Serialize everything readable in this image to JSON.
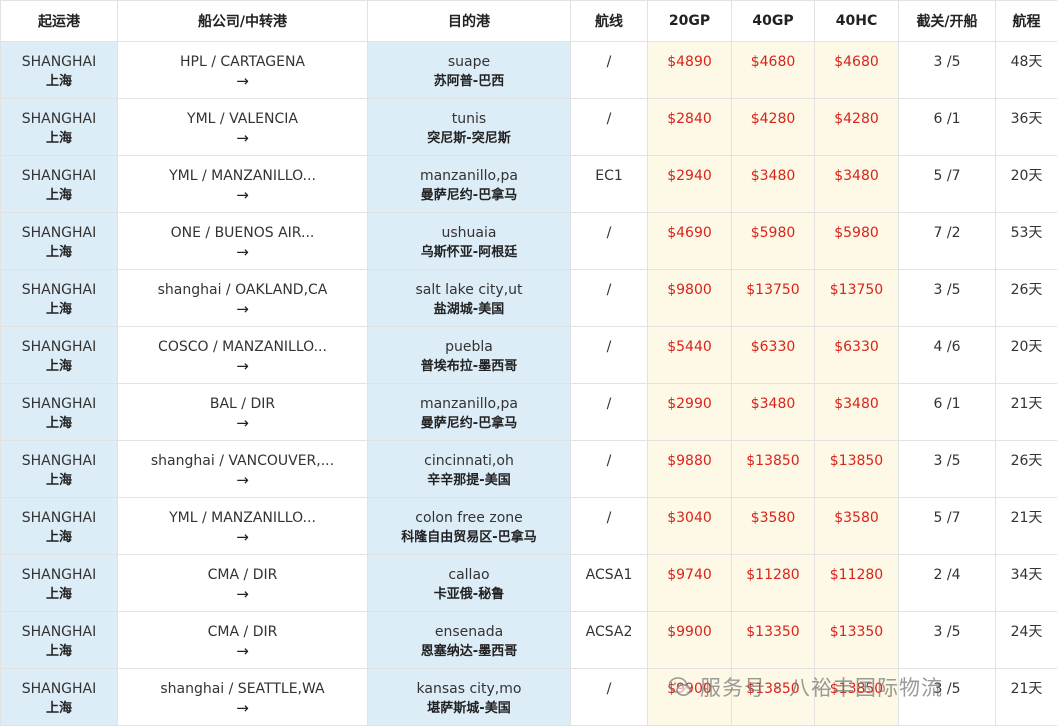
{
  "columns": [
    "起运港",
    "船公司/中转港",
    "目的港",
    "航线",
    "20GP",
    "40GP",
    "40HC",
    "截关/开船",
    "航程"
  ],
  "rows": [
    {
      "origin_en": "SHANGHAI",
      "origin_cn": "上海",
      "carrier": "HPL / CARTAGENA",
      "dest_en": "suape",
      "dest_cn": "苏阿普-巴西",
      "route": "/",
      "p20gp": "$4890",
      "p40gp": "$4680",
      "p40hc": "$4680",
      "cutoff": "3 /5",
      "transit": "48天"
    },
    {
      "origin_en": "SHANGHAI",
      "origin_cn": "上海",
      "carrier": "YML / VALENCIA",
      "dest_en": "tunis",
      "dest_cn": "突尼斯-突尼斯",
      "route": "/",
      "p20gp": "$2840",
      "p40gp": "$4280",
      "p40hc": "$4280",
      "cutoff": "6 /1",
      "transit": "36天"
    },
    {
      "origin_en": "SHANGHAI",
      "origin_cn": "上海",
      "carrier": "YML / MANZANILLO...",
      "dest_en": "manzanillo,pa",
      "dest_cn": "曼萨尼约-巴拿马",
      "route": "EC1",
      "p20gp": "$2940",
      "p40gp": "$3480",
      "p40hc": "$3480",
      "cutoff": "5 /7",
      "transit": "20天"
    },
    {
      "origin_en": "SHANGHAI",
      "origin_cn": "上海",
      "carrier": "ONE / BUENOS AIR...",
      "dest_en": "ushuaia",
      "dest_cn": "乌斯怀亚-阿根廷",
      "route": "/",
      "p20gp": "$4690",
      "p40gp": "$5980",
      "p40hc": "$5980",
      "cutoff": "7 /2",
      "transit": "53天"
    },
    {
      "origin_en": "SHANGHAI",
      "origin_cn": "上海",
      "carrier": "shanghai / OAKLAND,CA",
      "dest_en": "salt lake city,ut",
      "dest_cn": "盐湖城-美国",
      "route": "/",
      "p20gp": "$9800",
      "p40gp": "$13750",
      "p40hc": "$13750",
      "cutoff": "3 /5",
      "transit": "26天"
    },
    {
      "origin_en": "SHANGHAI",
      "origin_cn": "上海",
      "carrier": "COSCO / MANZANILLO...",
      "dest_en": "puebla",
      "dest_cn": "普埃布拉-墨西哥",
      "route": "/",
      "p20gp": "$5440",
      "p40gp": "$6330",
      "p40hc": "$6330",
      "cutoff": "4 /6",
      "transit": "20天"
    },
    {
      "origin_en": "SHANGHAI",
      "origin_cn": "上海",
      "carrier": "BAL / DIR",
      "dest_en": "manzanillo,pa",
      "dest_cn": "曼萨尼约-巴拿马",
      "route": "/",
      "p20gp": "$2990",
      "p40gp": "$3480",
      "p40hc": "$3480",
      "cutoff": "6 /1",
      "transit": "21天"
    },
    {
      "origin_en": "SHANGHAI",
      "origin_cn": "上海",
      "carrier": "shanghai / VANCOUVER,...",
      "dest_en": "cincinnati,oh",
      "dest_cn": "辛辛那提-美国",
      "route": "/",
      "p20gp": "$9880",
      "p40gp": "$13850",
      "p40hc": "$13850",
      "cutoff": "3 /5",
      "transit": "26天"
    },
    {
      "origin_en": "SHANGHAI",
      "origin_cn": "上海",
      "carrier": "YML / MANZANILLO...",
      "dest_en": "colon free zone",
      "dest_cn": "科隆自由贸易区-巴拿马",
      "route": "/",
      "p20gp": "$3040",
      "p40gp": "$3580",
      "p40hc": "$3580",
      "cutoff": "5 /7",
      "transit": "21天"
    },
    {
      "origin_en": "SHANGHAI",
      "origin_cn": "上海",
      "carrier": "CMA / DIR",
      "dest_en": "callao",
      "dest_cn": "卡亚俄-秘鲁",
      "route": "ACSA1",
      "p20gp": "$9740",
      "p40gp": "$11280",
      "p40hc": "$11280",
      "cutoff": "2 /4",
      "transit": "34天"
    },
    {
      "origin_en": "SHANGHAI",
      "origin_cn": "上海",
      "carrier": "CMA / DIR",
      "dest_en": "ensenada",
      "dest_cn": "恩塞纳达-墨西哥",
      "route": "ACSA2",
      "p20gp": "$9900",
      "p40gp": "$13350",
      "p40hc": "$13350",
      "cutoff": "3 /5",
      "transit": "24天"
    },
    {
      "origin_en": "SHANGHAI",
      "origin_cn": "上海",
      "carrier": "shanghai / SEATTLE,WA",
      "dest_en": "kansas city,mo",
      "dest_cn": "堪萨斯城-美国",
      "route": "/",
      "p20gp": "$9900",
      "p40gp": "$13850",
      "p40hc": "$13850",
      "cutoff": "3 /5",
      "transit": "21天"
    }
  ],
  "arrow_glyph": "→",
  "watermark": {
    "text": "服务号 · 八裕丰国际物流",
    "icon": "wechat-icon"
  },
  "colors": {
    "origin_bg": "#dcedf8",
    "price_bg": "#fdf9e6",
    "price_text": "#d9241b",
    "border": "#e2e2e2"
  }
}
